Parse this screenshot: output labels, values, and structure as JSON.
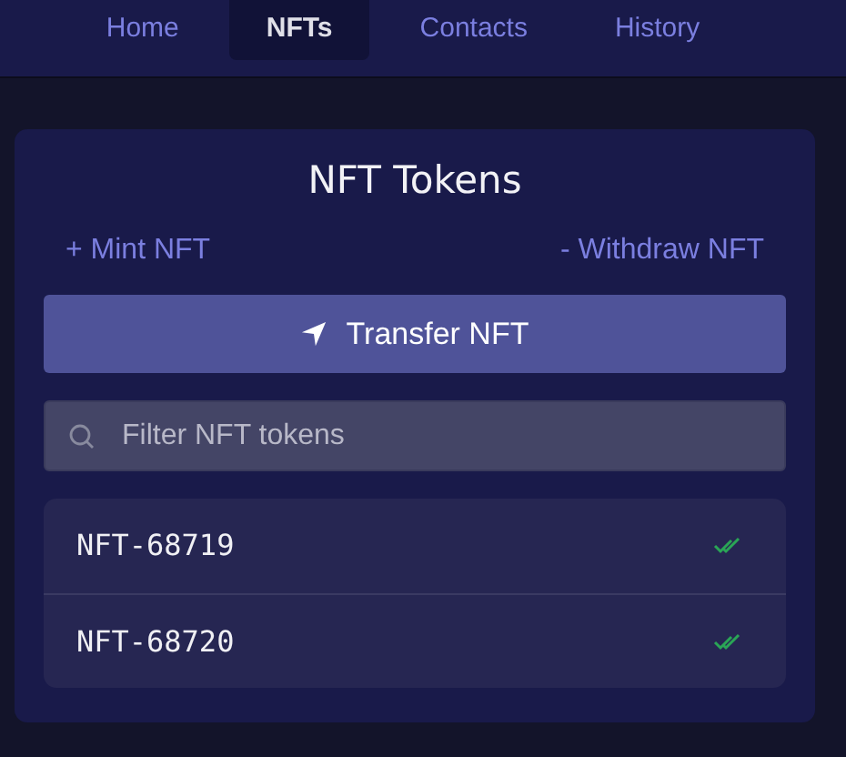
{
  "nav": {
    "tabs": [
      {
        "label": "Home",
        "selected": false
      },
      {
        "label": "NFTs",
        "selected": true
      },
      {
        "label": "Contacts",
        "selected": false
      },
      {
        "label": "History",
        "selected": false
      }
    ]
  },
  "card": {
    "title": "NFT Tokens",
    "mint_link": "+ Mint NFT",
    "withdraw_link": "- Withdraw NFT",
    "transfer_button": "Transfer NFT",
    "filter": {
      "placeholder": "Filter NFT tokens"
    },
    "tokens": [
      {
        "id": "NFT-68719",
        "confirmed": true
      },
      {
        "id": "NFT-68720",
        "confirmed": true
      }
    ]
  }
}
